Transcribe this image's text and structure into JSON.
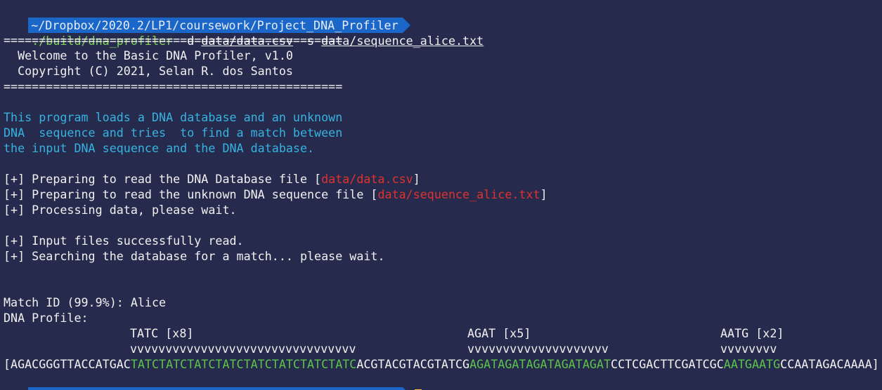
{
  "prompt": {
    "path": "~/Dropbox/2020.2/LP1/coursework/Project_DNA_Profiler",
    "command": "./build/dna_profiler",
    "flag_d": "-d",
    "arg_d": "data/data.csv",
    "flag_s": "-s",
    "arg_s": "data/sequence_alice.txt"
  },
  "banner": {
    "rule": "================================================",
    "welcome": "  Welcome to the Basic DNA Profiler, v1.0",
    "copyright": "  Copyright (C) 2021, Selan R. dos Santos"
  },
  "intro": [
    "This program loads a DNA database and an unknown",
    "DNA  sequence and tries  to find a match between",
    "the input DNA sequence and the DNA database."
  ],
  "log": {
    "read_db_prefix": "[+] Preparing to read the DNA Database file [",
    "read_db_file": "data/data.csv",
    "read_seq_prefix": "[+] Preparing to read the unknown DNA sequence file [",
    "read_seq_file": "data/sequence_alice.txt",
    "close_bracket": "]",
    "processing": "[+] Processing data, please wait.",
    "success": "[+] Input files successfully read.",
    "searching": "[+] Searching the database for a match... please wait."
  },
  "result": {
    "match": "Match ID (99.9%): Alice",
    "profile_label": "DNA Profile:",
    "str_labels": [
      "TATC [x8]",
      "AGAT [x5]",
      "AATG [x2]"
    ],
    "markers": [
      "vvvvvvvvvvvvvvvvvvvvvvvvvvvvvvvv",
      "vvvvvvvvvvvvvvvvvvvv",
      "vvvvvvvv"
    ],
    "sequence": {
      "open": "[",
      "seg1": "AGACGGGTTACCATGAC",
      "str1": "TATCTATCTATCTATCTATCTATCTATCTATC",
      "seg2": "ACGTACGTACGTATCG",
      "str2": "AGATAGATAGATAGATAGAT",
      "seg3": "CCTCGACTTCGATCGC",
      "str3": "AATGAATG",
      "seg4": "CCAATAGACAAAA",
      "close": "]"
    }
  },
  "colors": {
    "background": "#262a4d",
    "prompt_bg": "#1a66c9",
    "command": "#7fd35a",
    "info": "#36b3e0",
    "filename": "#e0322e",
    "str_highlight": "#5cc34a",
    "cursor": "#f5c542"
  }
}
